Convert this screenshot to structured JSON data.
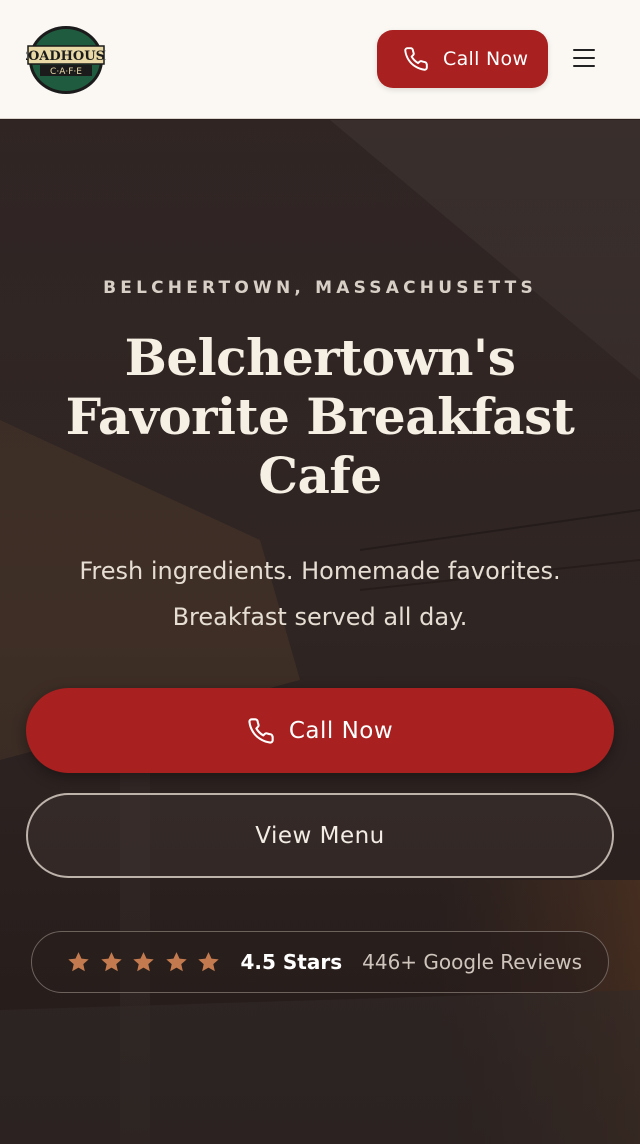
{
  "header": {
    "logo": {
      "line1": "ROADHOUSE",
      "line2": "C·A·F·E",
      "colors": {
        "ring": "#1f5b3e",
        "text": "#e9d9a6",
        "dark": "#1b1b1b"
      }
    },
    "call_label": "Call Now",
    "menu_icon": "hamburger-menu-icon"
  },
  "hero": {
    "eyebrow": "BELCHERTOWN, MASSACHUSETTS",
    "headline_lines": [
      "Belchertown's",
      "Favorite Breakfast",
      "Cafe"
    ],
    "subtext_lines": [
      "Fresh ingredients. Homemade favorites.",
      "Breakfast served all day."
    ],
    "primary_button": "Call Now",
    "secondary_button": "View Menu",
    "reviews": {
      "stars": 5,
      "rating": "4.5 Stars",
      "count": "446+ Google Reviews"
    }
  },
  "colors": {
    "accent": "#a8201f",
    "star": "#c27a4e",
    "header_bg": "#fbf8f3"
  }
}
